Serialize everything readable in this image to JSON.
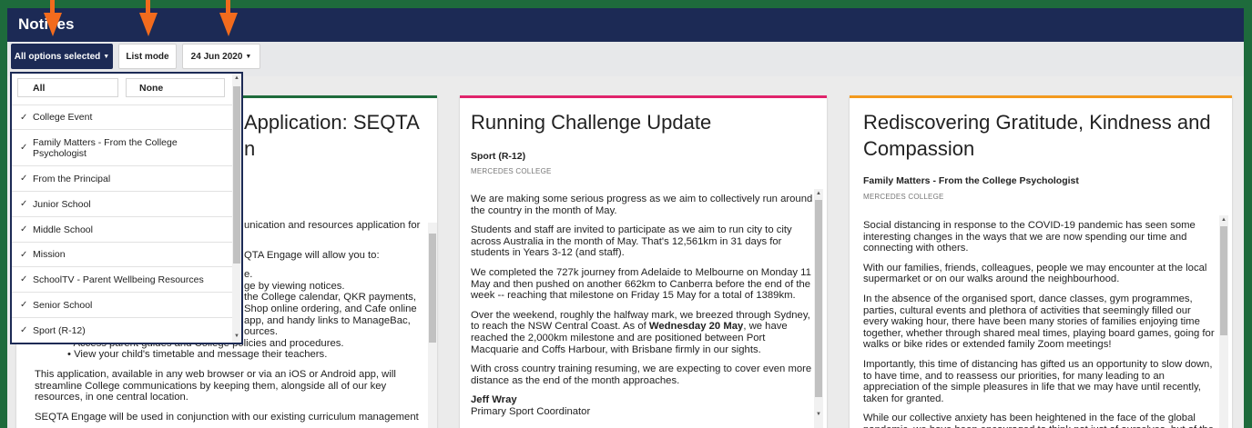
{
  "app": {
    "title": "Notices"
  },
  "toolbar": {
    "filter_label": "All options selected",
    "mode_label": "List mode",
    "date_label": "24 Jun 2020"
  },
  "dropdown": {
    "all_label": "All",
    "none_label": "None",
    "items": [
      {
        "label": "College Event",
        "checked": true
      },
      {
        "label": "Family Matters - From the College Psychologist",
        "checked": true
      },
      {
        "label": "From the Principal",
        "checked": true
      },
      {
        "label": "Junior School",
        "checked": true
      },
      {
        "label": "Middle School",
        "checked": true
      },
      {
        "label": "Mission",
        "checked": true
      },
      {
        "label": "SchoolTV - Parent Wellbeing Resources",
        "checked": true
      },
      {
        "label": "Senior School",
        "checked": true
      },
      {
        "label": "Sport (R-12)",
        "checked": true
      }
    ]
  },
  "cards": [
    {
      "accent": "#1e6b3c",
      "title_line1": "Application: SEQTA",
      "title_line2": "n",
      "body": {
        "p1": "unication and resources application for",
        "p2": "QTA Engage will allow you to:",
        "b1": "e.",
        "b2": "ge by viewing notices.",
        "b3": "the College calendar, QKR payments,",
        "b4": "Shop online ordering, and Cafe online",
        "b5": "app, and handy links to ManageBac,",
        "b6": "ources.",
        "b7": "Access parent guides and College policies and procedures.",
        "b8": "View your child's timetable and message their teachers.",
        "p3": "This application, available in any web browser or via an iOS or Android app, will streamline College communications by keeping them, alongside all of our key resources, in one central location.",
        "p4": "SEQTA Engage will be used in conjunction with our existing curriculum management"
      }
    },
    {
      "accent": "#e0246b",
      "title": "Running Challenge Update",
      "category": "Sport (R-12)",
      "source": "MERCEDES COLLEGE",
      "body": {
        "p1": "We are making some serious progress as we aim to collectively run around the country in the month of May.",
        "p2": "Students and staff are invited to participate as we aim to run city to city across Australia in the month of May. That's 12,561km in 31 days for students in Years 3-12 (and staff).",
        "p3": "We completed the 727k journey from Adelaide to Melbourne on Monday 11 May and then pushed on another 662km to Canberra before the end of the week -- reaching that milestone on Friday 15 May for a total of 1389km.",
        "p4a": "Over the weekend, roughly the halfway mark, we breezed through Sydney, to reach the NSW Central Coast. As of ",
        "p4b": "Wednesday 20 May",
        "p4c": ", we have reached the 2,000km milestone and are positioned between Port Macquarie and Coffs Harbour, with Brisbane firmly in our sights.",
        "p5": "With cross country training resuming, we are expecting to cover even more distance as the end of the month approaches.",
        "sig_name": "Jeff Wray",
        "sig_role": "Primary Sport Coordinator"
      }
    },
    {
      "accent": "#f39a1e",
      "title": "Rediscovering Gratitude, Kindness and Compassion",
      "category": "Family Matters - From the College Psychologist",
      "source": "MERCEDES COLLEGE",
      "body": {
        "p1": "Social distancing in response to the COVID-19 pandemic has seen some interesting changes in the ways that we are now spending our time and connecting with others.",
        "p2": "With our families, friends, colleagues, people we may encounter at the local supermarket or on our walks around the neighbourhood.",
        "p3": "In the absence of the organised sport, dance classes, gym programmes, parties, cultural events and plethora of activities that seemingly filled our every waking hour, there have been many stories of families enjoying time together, whether through shared meal times, playing board games, going for walks or bike rides or extended family Zoom meetings!",
        "p4": "Importantly, this time of distancing has gifted us an opportunity to slow down, to have time, and to reassess our priorities, for many leading to an appreciation of the simple pleasures in life that we may have until recently, taken for granted.",
        "p5": "While our collective anxiety has been heightened in the face of the global pandemic, we have been encouraged to think not just of ourselves, but of the"
      }
    }
  ],
  "colors": {
    "border": "#1e6b3c",
    "header": "#1c2a55",
    "annotation_arrow": "#f26b1d"
  }
}
